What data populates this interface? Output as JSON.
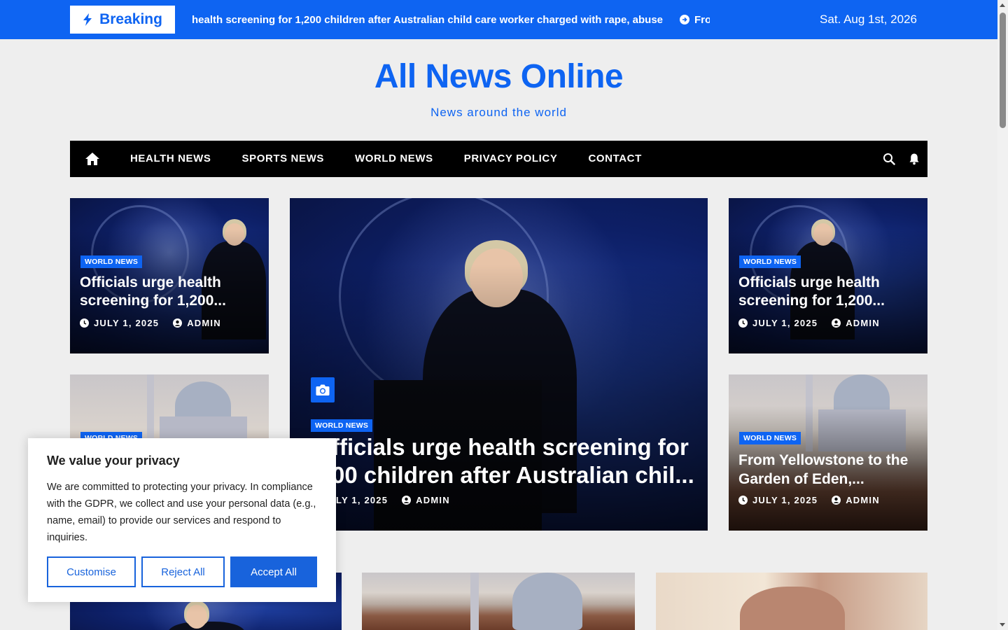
{
  "topbar": {
    "breaking_label": "Breaking",
    "ticker_text": "health screening for 1,200 children after Australian child care worker charged with rape, abuse",
    "ticker_next": "From Y",
    "date": "Sat. Aug 1st, 2026"
  },
  "header": {
    "title": "All News Online",
    "tagline": "News around the world"
  },
  "nav": {
    "items": [
      {
        "label": "HEALTH NEWS"
      },
      {
        "label": "SPORTS NEWS"
      },
      {
        "label": "WORLD NEWS"
      },
      {
        "label": "PRIVACY POLICY"
      },
      {
        "label": "CONTACT"
      }
    ]
  },
  "cards": {
    "left_top": {
      "category": "WORLD NEWS",
      "title": "Officials urge health screening for 1,200...",
      "date": "JULY 1, 2025",
      "author": "ADMIN"
    },
    "left_bottom": {
      "category": "WORLD NEWS"
    },
    "center": {
      "category": "WORLD NEWS",
      "title": "fficials urge health screening for 00 children after Australian chil...",
      "title_line1": "fficials urge health screening for",
      "title_line2": "00 children after Australian chil...",
      "date": "LY 1, 2025",
      "author": "ADMIN"
    },
    "right_top": {
      "category": "WORLD NEWS",
      "title": "Officials urge health screening for 1,200...",
      "date": "JULY 1, 2025",
      "author": "ADMIN"
    },
    "right_bottom": {
      "category": "WORLD NEWS",
      "title": "From Yellowstone to the Garden of Eden,...",
      "date": "JULY 1, 2025",
      "author": "ADMIN"
    }
  },
  "cookie": {
    "title": "We value your privacy",
    "body": "We are committed to protecting your privacy. In compliance with the GDPR, we collect and use your personal data (e.g., name, email) to provide our services and respond to inquiries.",
    "customise": "Customise",
    "reject": "Reject All",
    "accept": "Accept All"
  },
  "colors": {
    "accent": "#0e64f2",
    "nav_bg": "#000000",
    "page_bg": "#eeeeee",
    "cookie_accent": "#1863dc"
  }
}
